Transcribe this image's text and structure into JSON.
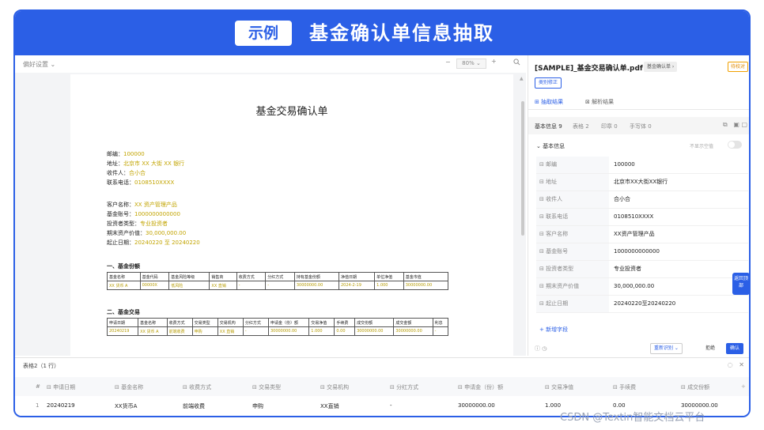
{
  "banner": {
    "tag": "示例",
    "title": "基金确认单信息抽取"
  },
  "viewer": {
    "toolbar": {
      "preferences": "偏好设置 ⌄",
      "zoom_minus": "−",
      "zoom": "80% ⌄",
      "zoom_plus": "+",
      "search_icon": "search-icon"
    },
    "doc_title": "基金交易确认单",
    "info": [
      {
        "k": "邮编：",
        "v": "100000"
      },
      {
        "k": "地址：",
        "v": "北京市 XX 大街 XX 银行"
      },
      {
        "k": "收件人：",
        "v": "合小合"
      },
      {
        "k": "联系电话：",
        "v": "0108510XXXX"
      }
    ],
    "info2": [
      {
        "k": "客户名称：",
        "v": "XX 资产管理产品"
      },
      {
        "k": "基金账号：",
        "v": "1000000000000"
      },
      {
        "k": "投资者类型：",
        "v": "专业投资者"
      },
      {
        "k": "期末资产价值：",
        "v": "30,000,000.00"
      },
      {
        "k": "起止日期：",
        "v": "20240220 至 20240220"
      }
    ],
    "section1": "一、基金份额",
    "table1": {
      "headers": [
        "基金名称",
        "基金代码",
        "基金风险等级",
        "销售商",
        "收费方式",
        "分红方式",
        "持有基金份额",
        "净值日期",
        "单位净值",
        "基金市值"
      ],
      "row": [
        "XX 货币 A",
        "00000X",
        "低风险",
        "XX 直销",
        "-",
        "-",
        "30000000.00",
        "2024-2-19",
        "1.000",
        "30000000.00"
      ]
    },
    "section2": "二、基金交易",
    "table2": {
      "headers": [
        "申请日期",
        "基金名称",
        "收费方式",
        "交易类型",
        "交易机构",
        "分红方式",
        "申请金（份）额",
        "交易净值",
        "手续费",
        "成交份额",
        "成交金额",
        "利息"
      ],
      "row": [
        "20240219",
        "XX 货币 A",
        "前端收费",
        "申购",
        "XX 直销",
        "-",
        "30000000.00",
        "1.000",
        "0.00",
        "30000000.00",
        "30000000.00",
        "-"
      ]
    }
  },
  "panel": {
    "file_name": "[SAMPLE]_基金交易确认单.pdf",
    "doc_type": "基金确认单 ›",
    "status": "待校对",
    "fix_button": "类别修正",
    "tabs": [
      "抽取结果",
      "解析结果"
    ],
    "subtabs": [
      "基本信息 9",
      "表格 2",
      "印章 0",
      "手写体 0"
    ],
    "group": "基本信息",
    "hide_empty": "不显示空值",
    "fields": [
      {
        "label": "邮编",
        "value": "100000"
      },
      {
        "label": "地址",
        "value": "北京市XX大街XX银行"
      },
      {
        "label": "收件人",
        "value": "合小合"
      },
      {
        "label": "联系电话",
        "value": "0108510XXXX"
      },
      {
        "label": "客户名称",
        "value": "XX资产管理产品"
      },
      {
        "label": "基金账号",
        "value": "1000000000000"
      },
      {
        "label": "投资者类型",
        "value": "专业投资者"
      },
      {
        "label": "期末资产价值",
        "value": "30,000,000.00"
      },
      {
        "label": "起止日期",
        "value": "20240220至20240220"
      }
    ],
    "add_field": "+ 新增字段",
    "reidentify": "重新识别 ⌄",
    "reject": "拒绝",
    "confirm": "确认",
    "fab": "返回顶部"
  },
  "bottom_table": {
    "title": "表格2（1 行）",
    "headers": [
      "#",
      "申请日期",
      "基金名称",
      "收费方式",
      "交易类型",
      "交易机构",
      "分红方式",
      "申请金（份）额",
      "交易净值",
      "手续费",
      "成交份额"
    ],
    "row": [
      "1",
      "20240219",
      "XX货币A",
      "前端收费",
      "申购",
      "XX直销",
      "-",
      "30000000.00",
      "1.000",
      "0.00",
      "30000000.00"
    ]
  },
  "watermark": "CSDN @Textin智能文档云平台"
}
